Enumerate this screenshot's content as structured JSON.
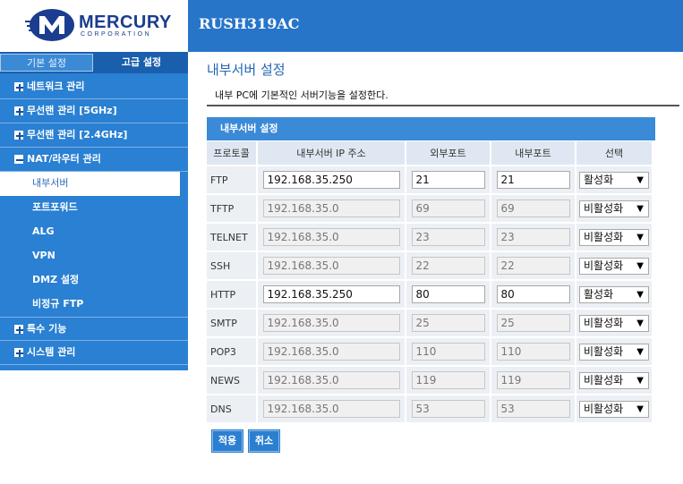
{
  "brand": {
    "name": "MERCURY",
    "sub": "CORPORATION",
    "model": "RUSH319AC"
  },
  "sidebar": {
    "tabs": [
      {
        "label": "기본 설정"
      },
      {
        "label": "고급 설정"
      }
    ],
    "menu": [
      {
        "label": "네트워크 관리",
        "toggle": "plus"
      },
      {
        "label": "무선랜 관리 [5GHz]",
        "toggle": "plus"
      },
      {
        "label": "무선랜 관리 [2.4GHz]",
        "toggle": "plus"
      },
      {
        "label": "NAT/라우터 관리",
        "toggle": "minus"
      }
    ],
    "submenu": [
      {
        "label": "내부서버",
        "active": true
      },
      {
        "label": "포트포워드"
      },
      {
        "label": "ALG"
      },
      {
        "label": "VPN"
      },
      {
        "label": "DMZ 설정"
      },
      {
        "label": "비정규 FTP"
      }
    ],
    "menu_after": [
      {
        "label": "특수 기능",
        "toggle": "plus"
      },
      {
        "label": "시스템 관리",
        "toggle": "plus"
      }
    ]
  },
  "content": {
    "title": "내부서버 설정",
    "description": "내부 PC에 기본적인 서버기능을 설정한다.",
    "panel_title": "내부서버 설정",
    "columns": [
      "프로토콜",
      "내부서버 IP 주소",
      "외부포트",
      "내부포트",
      "선택"
    ],
    "rows": [
      {
        "protocol": "FTP",
        "ip": "192.168.35.250",
        "ext": "21",
        "int": "21",
        "state": "활성화",
        "enabled": true
      },
      {
        "protocol": "TFTP",
        "ip": "192.168.35.0",
        "ext": "69",
        "int": "69",
        "state": "비활성화",
        "enabled": false
      },
      {
        "protocol": "TELNET",
        "ip": "192.168.35.0",
        "ext": "23",
        "int": "23",
        "state": "비활성화",
        "enabled": false
      },
      {
        "protocol": "SSH",
        "ip": "192.168.35.0",
        "ext": "22",
        "int": "22",
        "state": "비활성화",
        "enabled": false
      },
      {
        "protocol": "HTTP",
        "ip": "192.168.35.250",
        "ext": "80",
        "int": "80",
        "state": "활성화",
        "enabled": true
      },
      {
        "protocol": "SMTP",
        "ip": "192.168.35.0",
        "ext": "25",
        "int": "25",
        "state": "비활성화",
        "enabled": false
      },
      {
        "protocol": "POP3",
        "ip": "192.168.35.0",
        "ext": "110",
        "int": "110",
        "state": "비활성화",
        "enabled": false
      },
      {
        "protocol": "NEWS",
        "ip": "192.168.35.0",
        "ext": "119",
        "int": "119",
        "state": "비활성화",
        "enabled": false
      },
      {
        "protocol": "DNS",
        "ip": "192.168.35.0",
        "ext": "53",
        "int": "53",
        "state": "비활성화",
        "enabled": false
      }
    ],
    "buttons": {
      "apply": "적용",
      "cancel": "취소"
    }
  },
  "colors": {
    "header_blue": "#2775c9",
    "sidebar_blue": "#2a80d2",
    "brand_navy": "#1a3d8f"
  }
}
